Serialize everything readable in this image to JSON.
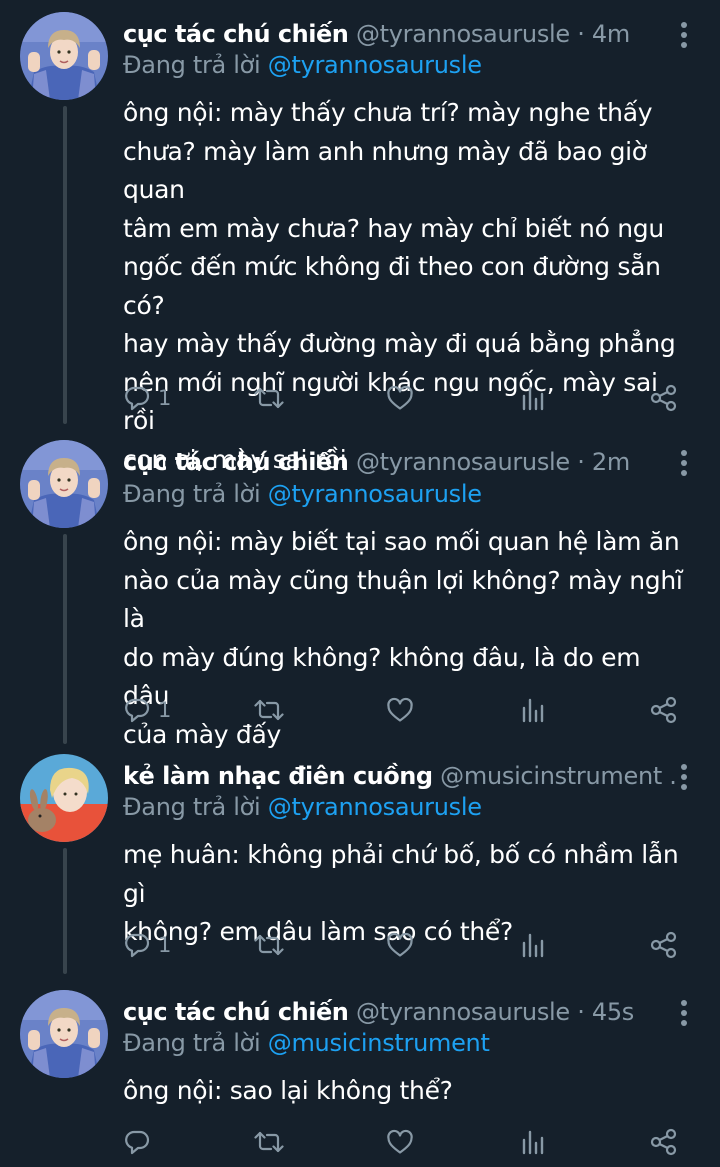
{
  "tweets": [
    {
      "name": "cục tác chú chiến",
      "handle": "@tyrannosaurusle · 4m",
      "replying_prefix": "Đang trả lời",
      "replying_to": "@tyrannosaurusle",
      "lines": [
        "ông nội: mày thấy chưa trí? mày nghe thấy",
        "chưa? mày làm anh nhưng mày đã bao giờ quan",
        "tâm em mày chưa? hay mày chỉ biết nó ngu",
        "ngốc đến mức không đi theo con đường sẵn có?",
        "hay mày thấy đường mày đi quá bằng phẳng",
        "nên mới nghĩ người khác ngu ngốc, mày sai rồi",
        "con ơi, mày sai rồi"
      ],
      "reply_count": "1",
      "avatar": "boy-avatar"
    },
    {
      "name": "cục tác chú chiến",
      "handle": "@tyrannosaurusle · 2m",
      "replying_prefix": "Đang trả lời",
      "replying_to": "@tyrannosaurusle",
      "lines": [
        "ông nội: mày biết tại sao mối quan hệ làm ăn",
        "nào của mày cũng thuận lợi không? mày nghĩ là",
        "do mày đúng không? không đâu, là do em dâu",
        "của mày đấy"
      ],
      "reply_count": "1",
      "avatar": "boy-avatar"
    },
    {
      "name": "kẻ làm nhạc điên cuồng",
      "handle": "@musicinstrument ...",
      "replying_prefix": "Đang trả lời",
      "replying_to": "@tyrannosaurusle",
      "lines": [
        "mẹ huân: không phải chứ bố, bố có nhầm lẫn gì",
        "không? em dâu làm sao có thể?"
      ],
      "reply_count": "1",
      "avatar": "blonde-avatar"
    },
    {
      "name": "cục tác chú chiến",
      "handle": "@tyrannosaurusle · 45s",
      "replying_prefix": "Đang trả lời",
      "replying_to": "@musicinstrument",
      "lines": [
        "ông nội: sao lại không thể?"
      ],
      "reply_count": "",
      "avatar": "boy-avatar"
    }
  ],
  "colors": {
    "background": "#15202b",
    "muted": "#8899a6",
    "accent": "#1da1f2",
    "thread_line": "#38444d"
  },
  "icons": [
    "reply-icon",
    "retweet-icon",
    "like-icon",
    "analytics-icon",
    "share-icon",
    "more-icon"
  ]
}
